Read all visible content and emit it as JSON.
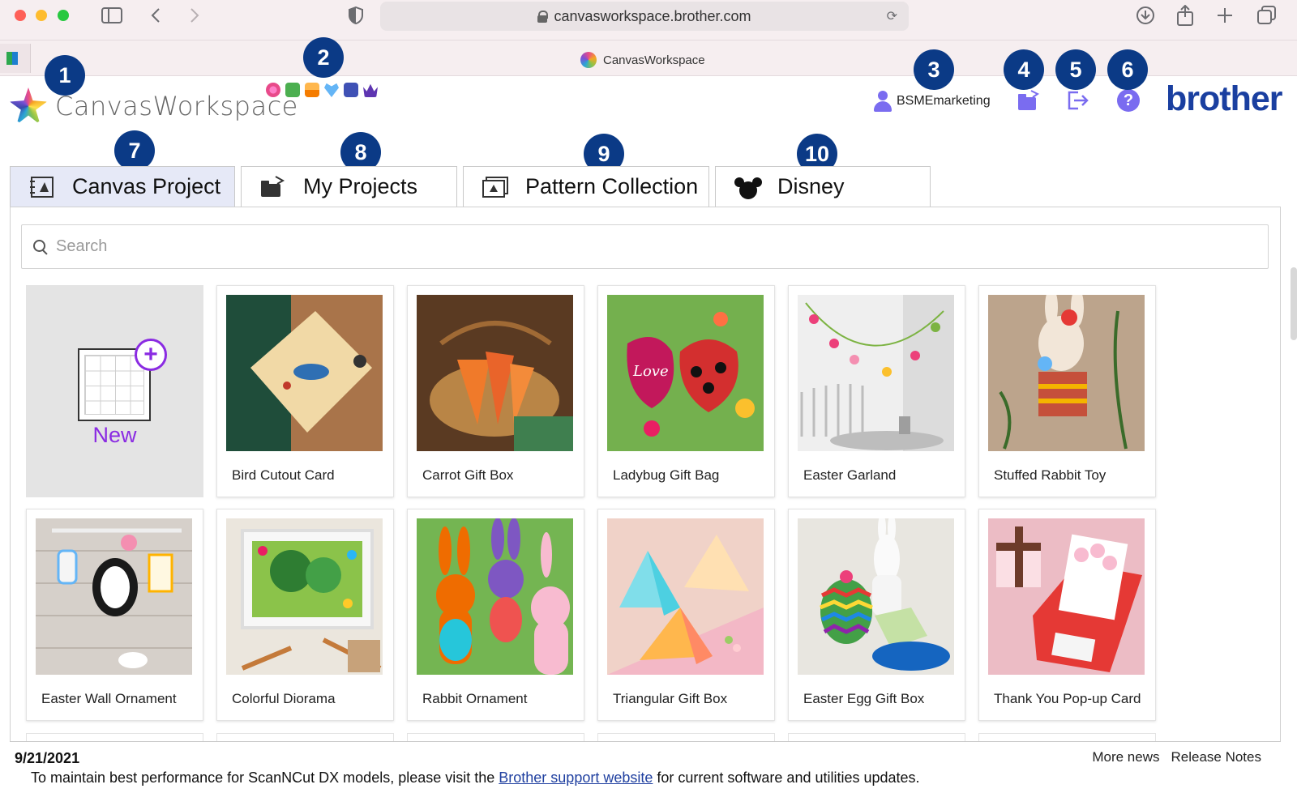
{
  "browser": {
    "url": "canvasworkspace.brother.com",
    "tab_title": "CanvasWorkspace"
  },
  "app": {
    "logo_text": "CanvasWorkspace",
    "user": "BSMEmarketing",
    "brand": "brother"
  },
  "callouts": [
    "1",
    "2",
    "3",
    "4",
    "5",
    "6",
    "7",
    "8",
    "9",
    "10"
  ],
  "tabs": [
    {
      "label": "Canvas Project"
    },
    {
      "label": "My Projects"
    },
    {
      "label": "Pattern Collection"
    },
    {
      "label": "Disney"
    }
  ],
  "search": {
    "placeholder": "Search"
  },
  "new_card": {
    "label": "New"
  },
  "projects": [
    {
      "title": "Bird Cutout Card"
    },
    {
      "title": "Carrot Gift Box"
    },
    {
      "title": "Ladybug Gift Bag"
    },
    {
      "title": "Easter Garland"
    },
    {
      "title": "Stuffed Rabbit Toy"
    },
    {
      "title": "Easter Wall Ornament"
    },
    {
      "title": "Colorful Diorama"
    },
    {
      "title": "Rabbit Ornament"
    },
    {
      "title": "Triangular Gift Box"
    },
    {
      "title": "Easter Egg Gift Box"
    },
    {
      "title": "Thank You Pop-up Card"
    }
  ],
  "news": {
    "date": "9/21/2021",
    "more_news": "More news",
    "release_notes": "Release Notes",
    "text_before": "To maintain best performance for ScanNCut DX models, please visit the ",
    "link_text": "Brother support website",
    "text_after": " for current software and utilities updates."
  },
  "colors": {
    "accent": "#7a6cf0",
    "callout": "#0b3a86",
    "brand": "#1a3fa0",
    "new": "#8a2be2"
  }
}
